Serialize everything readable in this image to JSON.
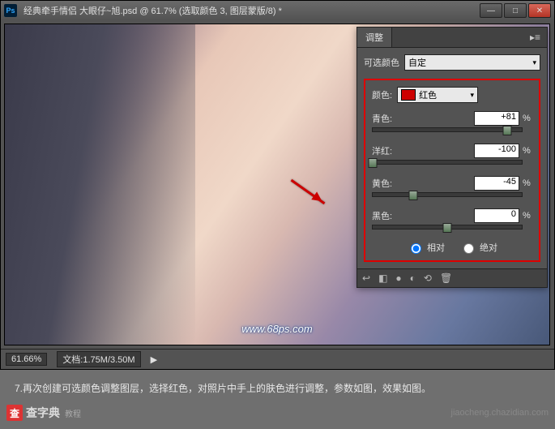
{
  "titlebar": {
    "ps": "Ps",
    "title": "经典牵手情侣    大眼仔~旭.psd @ 61.7% (选取颜色 3, 图层蒙版/8) *"
  },
  "panel": {
    "tab": "调整",
    "preset_label": "可选颜色",
    "preset_value": "自定",
    "color_label": "颜色:",
    "color_value": "红色",
    "sliders": {
      "cyan": {
        "label": "青色:",
        "value": "+81",
        "pos": 90
      },
      "magenta": {
        "label": "洋红:",
        "value": "-100",
        "pos": 0
      },
      "yellow": {
        "label": "黄色:",
        "value": "-45",
        "pos": 27
      },
      "black": {
        "label": "黑色:",
        "value": "0",
        "pos": 50
      }
    },
    "radio_rel": "相对",
    "radio_abs": "绝对"
  },
  "statusbar": {
    "zoom": "61.66%",
    "doc": "文档:1.75M/3.50M"
  },
  "watermark": "www.68ps.com",
  "caption": "7.再次创建可选颜色调整图层，选择红色，对照片中手上的肤色进行调整，参数如图，效果如图。",
  "footer": {
    "brand_mark": "查",
    "brand": "查字典",
    "brand_sub": "教程",
    "url": "jiaocheng.chazidian.com"
  }
}
